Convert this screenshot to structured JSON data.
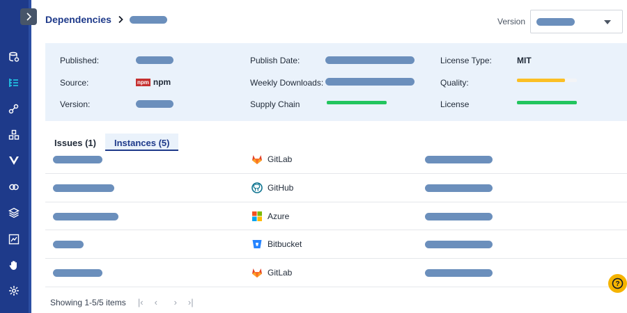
{
  "header": {
    "breadcrumb_root": "Dependencies",
    "version_label": "Version"
  },
  "info": {
    "published_label": "Published:",
    "source_label": "Source:",
    "source_badge": "npm",
    "source_value": "npm",
    "version_label": "Version:",
    "publish_date_label": "Publish Date:",
    "weekly_downloads_label": "Weekly Downloads:",
    "supply_chain_label": "Supply Chain",
    "supply_chain_score": 1.0,
    "license_type_label": "License Type:",
    "license_type_value": "MIT",
    "quality_label": "Quality:",
    "quality_score": 0.8,
    "license_label": "License",
    "license_score": 1.0
  },
  "tabs": [
    {
      "label": "Issues (1)",
      "active": false
    },
    {
      "label": "Instances (5)",
      "active": true
    }
  ],
  "instances": [
    {
      "source": "GitLab",
      "icon": "gitlab-icon"
    },
    {
      "source": "GitHub",
      "icon": "github-icon"
    },
    {
      "source": "Azure",
      "icon": "azure-icon"
    },
    {
      "source": "Bitbucket",
      "icon": "bitbucket-icon"
    },
    {
      "source": "GitLab",
      "icon": "gitlab-icon"
    }
  ],
  "pagination": {
    "summary": "Showing 1-5/5 items",
    "first": "|‹",
    "prev": "‹",
    "next": "›",
    "last": "›|"
  },
  "help": {
    "label": "?"
  },
  "colors": {
    "sidebar": "#1e3a8a",
    "accent": "#1e3a8a",
    "panel": "#eaf2fb",
    "good": "#22c55e",
    "warn": "#fbbf24",
    "help": "#f5b400"
  }
}
